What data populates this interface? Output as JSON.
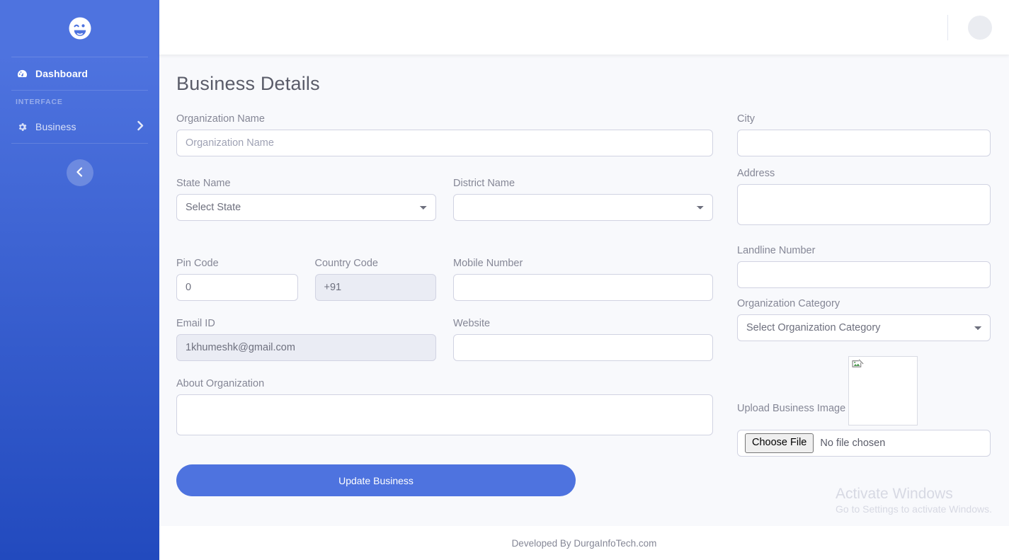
{
  "sidebar": {
    "brand_icon": "laugh-wink-icon",
    "items": [
      {
        "label": "Dashboard",
        "icon": "tachometer-icon"
      }
    ],
    "heading": "INTERFACE",
    "section_items": [
      {
        "label": "Business",
        "icon": "cog-icon",
        "chevron": "chevron-right-icon"
      }
    ],
    "toggle_icon": "chevron-left-icon"
  },
  "topbar": {
    "avatar": "user-avatar"
  },
  "page": {
    "title": "Business Details"
  },
  "form": {
    "organization_name": {
      "label": "Organization Name",
      "placeholder": "Organization Name",
      "value": ""
    },
    "state_name": {
      "label": "State Name",
      "selected": "Select State"
    },
    "district_name": {
      "label": "District Name",
      "selected": ""
    },
    "pin_code": {
      "label": "Pin Code",
      "value": "0"
    },
    "country_code": {
      "label": "Country Code",
      "value": "+91"
    },
    "mobile_number": {
      "label": "Mobile Number",
      "value": ""
    },
    "email_id": {
      "label": "Email ID",
      "value": "1khumeshk@gmail.com"
    },
    "website": {
      "label": "Website",
      "value": ""
    },
    "about_organization": {
      "label": "About Organization",
      "value": ""
    },
    "city": {
      "label": "City",
      "value": ""
    },
    "address": {
      "label": "Address",
      "value": ""
    },
    "landline_number": {
      "label": "Landline Number",
      "value": ""
    },
    "organization_category": {
      "label": "Organization Category",
      "selected": "Select Organization Category"
    },
    "upload_business_image": {
      "label": "Upload Business Image",
      "button": "Choose File",
      "status": "No file chosen"
    },
    "submit": {
      "label": "Update Business"
    }
  },
  "watermark": {
    "line1": "Activate Windows",
    "line2": "Go to Settings to activate Windows."
  },
  "footer": {
    "text": "Developed By DurgaInfoTech.com"
  },
  "colors": {
    "sidebar_start": "#4e73df",
    "sidebar_end": "#224abe",
    "primary": "#4e73df",
    "page_bg": "#f8f9fc",
    "label": "#858796",
    "border": "#d1d3e2",
    "disabled_bg": "#eaecf4",
    "title": "#5a5c69"
  }
}
